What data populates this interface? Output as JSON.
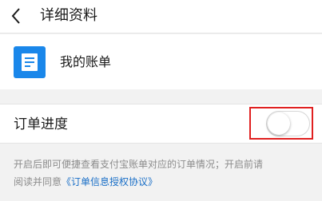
{
  "nav": {
    "title": "详细资料",
    "back_icon": "chevron-left-icon"
  },
  "bill_row": {
    "label": "我的账单",
    "icon": "bill-document-icon",
    "icon_color": "#1a87ea"
  },
  "order_progress": {
    "label": "订单进度",
    "toggle_on": false,
    "highlight_color": "#e02020"
  },
  "description": {
    "line1": "开启后即可便捷查看支付宝账单对应的订单情况；开启前请",
    "line2_prefix": "阅读并同意",
    "agreement_link": "《订单信息授权协议》",
    "link_color": "#1a6fc7"
  }
}
